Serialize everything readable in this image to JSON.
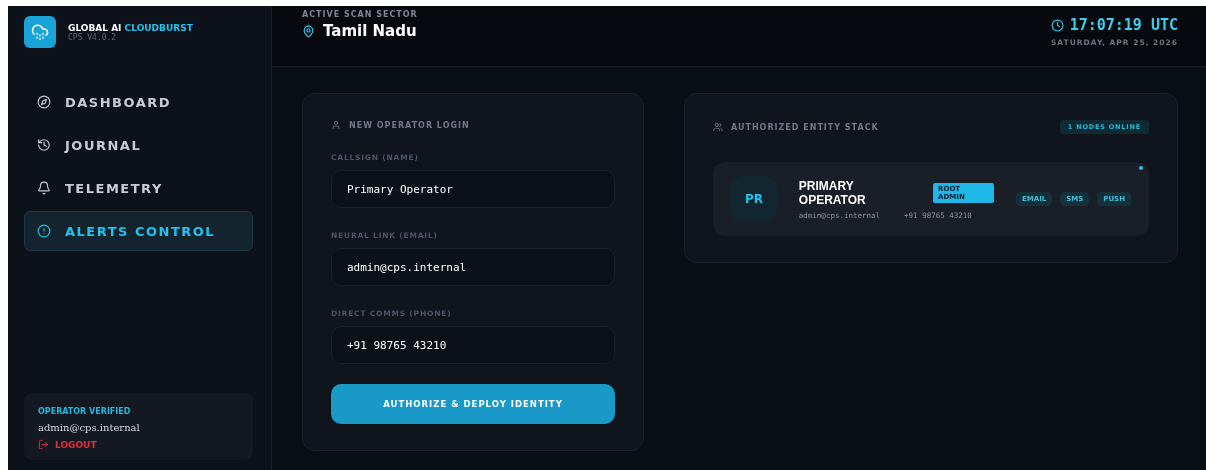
{
  "brand": {
    "name": "GLOBAL AI",
    "highlight": "CLOUDBURST",
    "version": "CPS V4.0.2"
  },
  "nav": [
    {
      "kind": "dashboard",
      "label": "DASHBOARD",
      "selected": false
    },
    {
      "kind": "journal",
      "label": "JOURNAL",
      "selected": false
    },
    {
      "kind": "telemetry",
      "label": "TELEMETRY",
      "selected": false
    },
    {
      "kind": "alerts",
      "label": "ALERTS CONTROL",
      "selected": true
    }
  ],
  "operator": {
    "status": "OPERATOR VERIFIED",
    "email": "admin@cps.internal",
    "logout": "LOGOUT"
  },
  "header": {
    "sector_label": "ACTIVE SCAN SECTOR",
    "sector": "Tamil Nadu",
    "time": "17:07:19 UTC",
    "date": "SATURDAY, APR 25, 2026"
  },
  "login": {
    "title": "NEW OPERATOR LOGIN",
    "fields": [
      {
        "label": "CALLSIGN (NAME)",
        "value": "Primary Operator"
      },
      {
        "label": "NEURAL LINK (EMAIL)",
        "value": "admin@cps.internal"
      },
      {
        "label": "DIRECT COMMS (PHONE)",
        "value": "+91 98765 43210"
      }
    ],
    "button": "AUTHORIZE & DEPLOY IDENTITY"
  },
  "stack": {
    "title": "AUTHORIZED ENTITY STACK",
    "count": "1 NODES ONLINE",
    "entities": [
      {
        "initials": "PR",
        "name": "PRIMARY OPERATOR",
        "role": "ROOT ADMIN",
        "email": "admin@cps.internal",
        "phone": "+91 98765 43210",
        "online": true,
        "channels": [
          "EMAIL",
          "SMS",
          "PUSH"
        ]
      }
    ]
  }
}
